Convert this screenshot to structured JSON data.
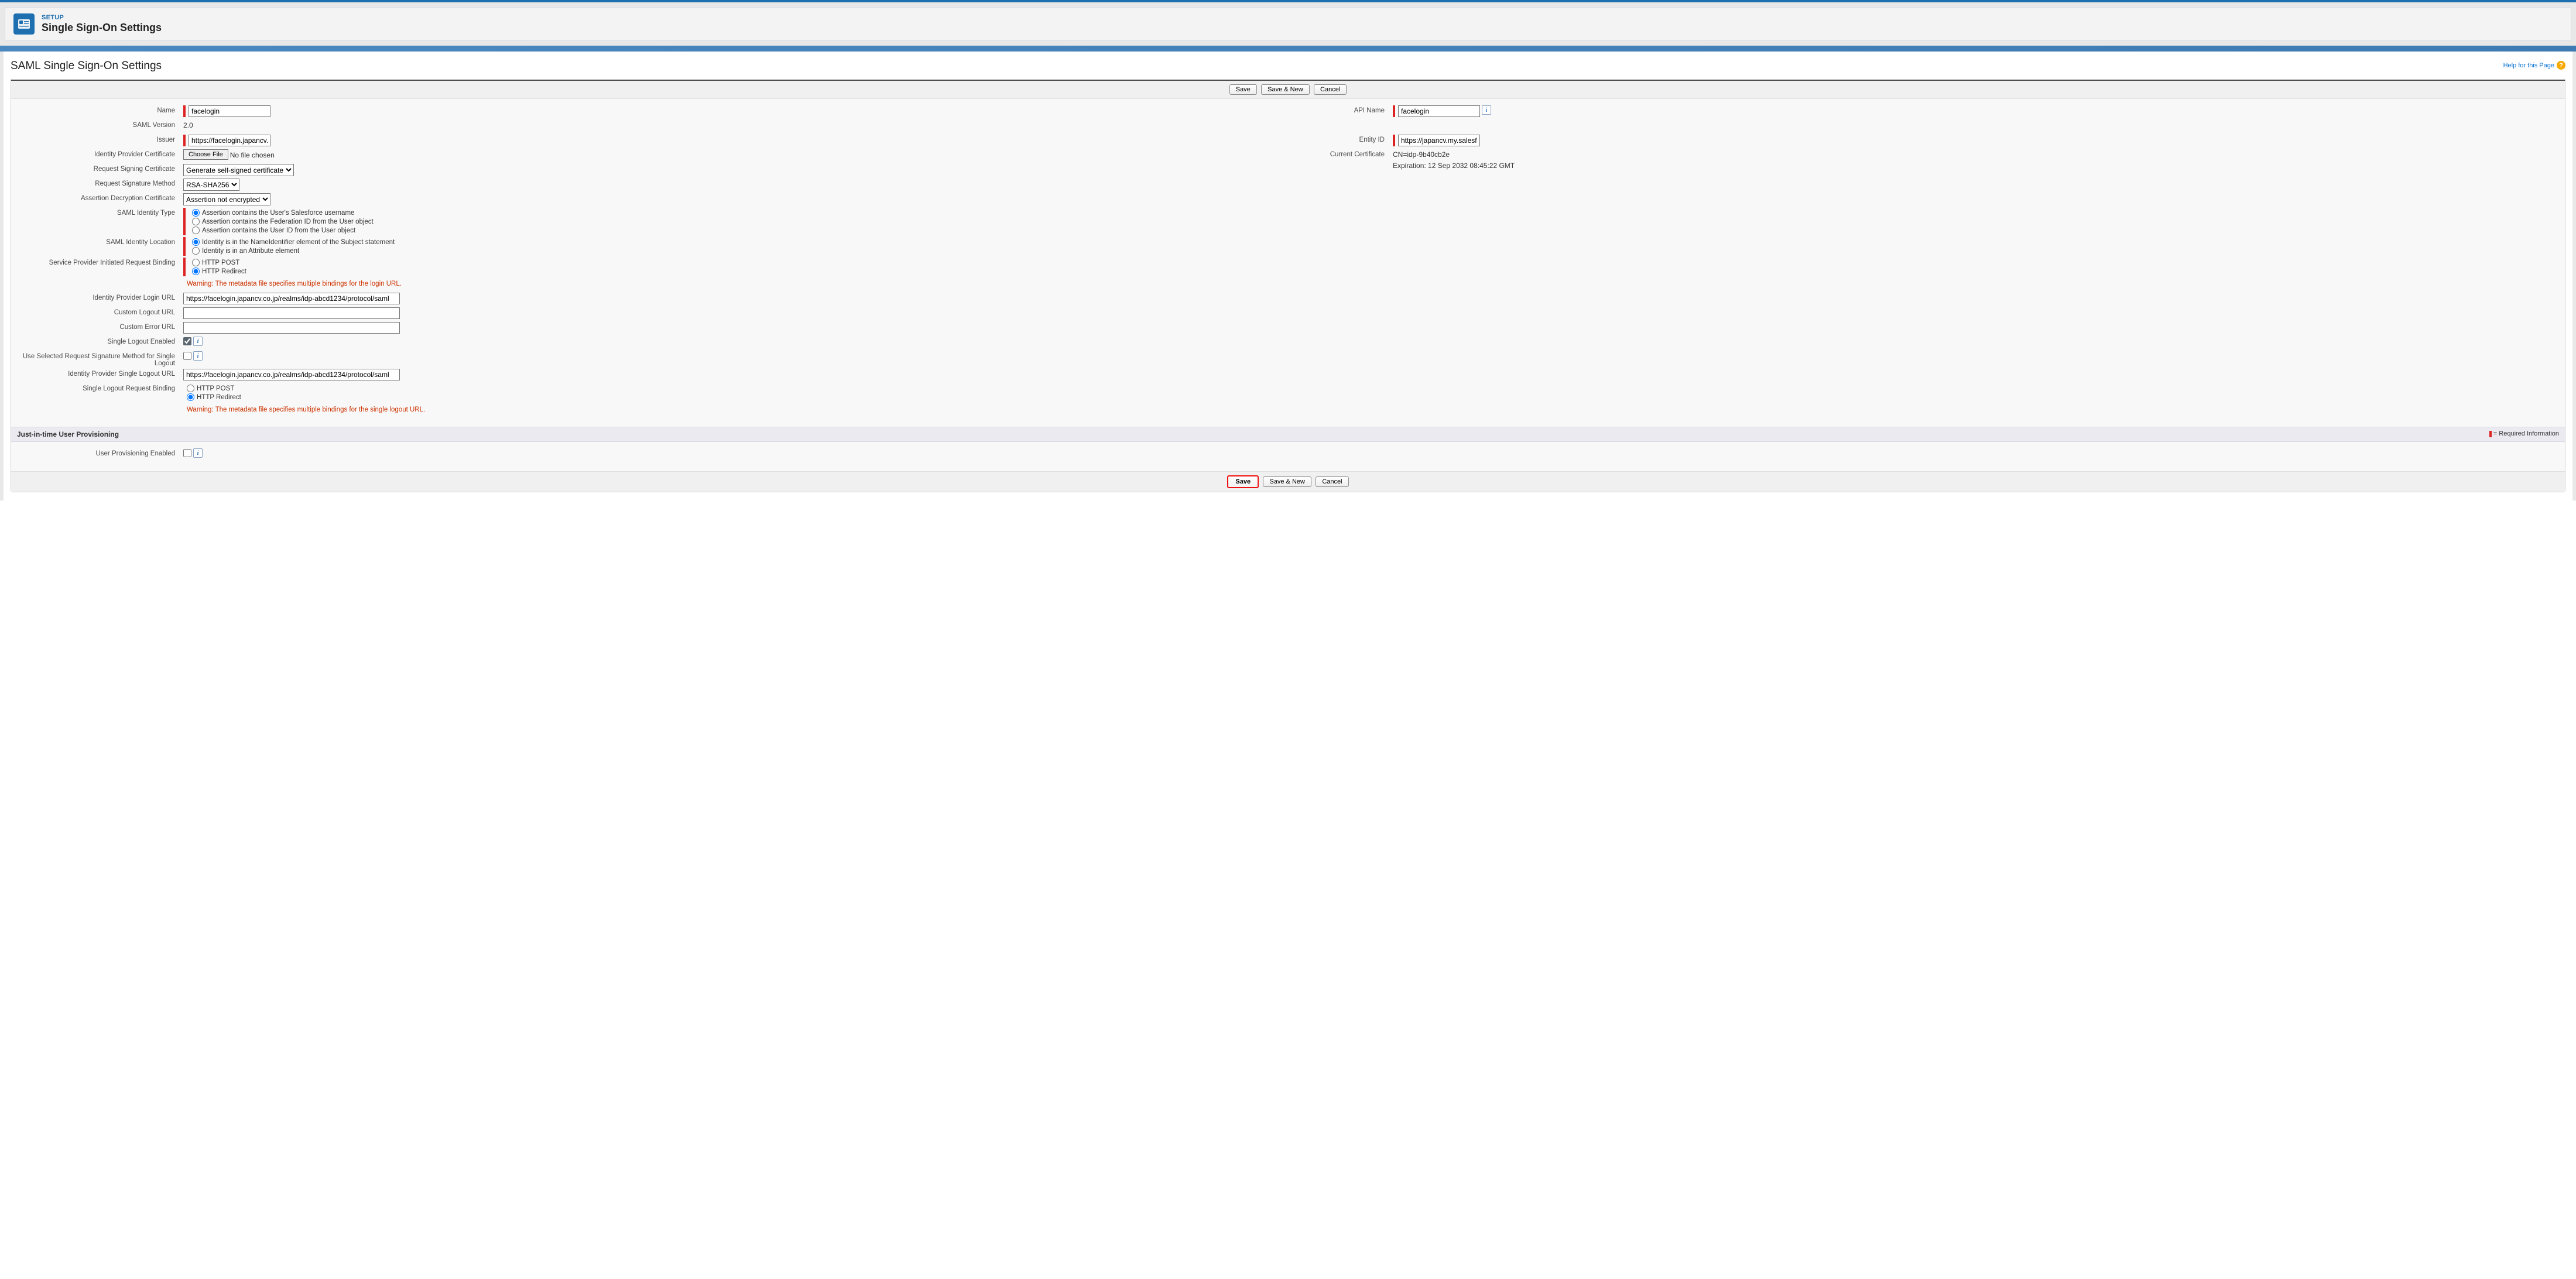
{
  "header": {
    "eyebrow": "SETUP",
    "title": "Single Sign-On Settings"
  },
  "page": {
    "section_title": "SAML Single Sign-On Settings",
    "help_link": "Help for this Page"
  },
  "buttons": {
    "save": "Save",
    "save_new": "Save & New",
    "cancel": "Cancel"
  },
  "labels": {
    "name": "Name",
    "api_name": "API Name",
    "saml_version": "SAML Version",
    "issuer": "Issuer",
    "entity_id": "Entity ID",
    "idp_cert": "Identity Provider Certificate",
    "current_cert": "Current Certificate",
    "req_sign_cert": "Request Signing Certificate",
    "req_sig_method": "Request Signature Method",
    "assertion_decrypt": "Assertion Decryption Certificate",
    "saml_identity_type": "SAML Identity Type",
    "saml_identity_location": "SAML Identity Location",
    "sp_initiated_binding": "Service Provider Initiated Request Binding",
    "idp_login_url": "Identity Provider Login URL",
    "custom_logout_url": "Custom Logout URL",
    "custom_error_url": "Custom Error URL",
    "single_logout_enabled": "Single Logout Enabled",
    "use_selected_req_sig_slo": "Use Selected Request Signature Method for Single Logout",
    "idp_slo_url": "Identity Provider Single Logout URL",
    "slo_request_binding": "Single Logout Request Binding",
    "user_prov_enabled": "User Provisioning Enabled"
  },
  "values": {
    "name": "facelogin",
    "api_name": "facelogin",
    "saml_version": "2.0",
    "issuer": "https://facelogin.japancv.co.jp",
    "entity_id": "https://japancv.my.salesforce",
    "choose_file": "Choose File",
    "no_file": "No file chosen",
    "current_cert_line1": "CN=idp-9b40cb2e",
    "current_cert_line2": "Expiration: 12 Sep 2032 08:45:22 GMT",
    "req_sign_cert": "Generate self-signed certificate",
    "req_sig_method": "RSA-SHA256",
    "assertion_decrypt": "Assertion not encrypted",
    "idp_login_url": "https://facelogin.japancv.co.jp/realms/idp-abcd1234/protocol/saml",
    "custom_logout_url": "",
    "custom_error_url": "",
    "idp_slo_url": "https://facelogin.japancv.co.jp/realms/idp-abcd1234/protocol/saml"
  },
  "radios": {
    "identity_type": {
      "opt1": "Assertion contains the User's Salesforce username",
      "opt2": "Assertion contains the Federation ID from the User object",
      "opt3": "Assertion contains the User ID from the User object"
    },
    "identity_location": {
      "opt1": "Identity is in the NameIdentifier element of the Subject statement",
      "opt2": "Identity is in an Attribute element"
    },
    "binding": {
      "post": "HTTP POST",
      "redirect": "HTTP Redirect"
    }
  },
  "warnings": {
    "login": "Warning: The metadata file specifies multiple bindings for the login URL.",
    "slo": "Warning: The metadata file specifies multiple bindings for the single logout URL."
  },
  "jit": {
    "header": "Just-in-time User Provisioning",
    "required": "= Required Information"
  }
}
